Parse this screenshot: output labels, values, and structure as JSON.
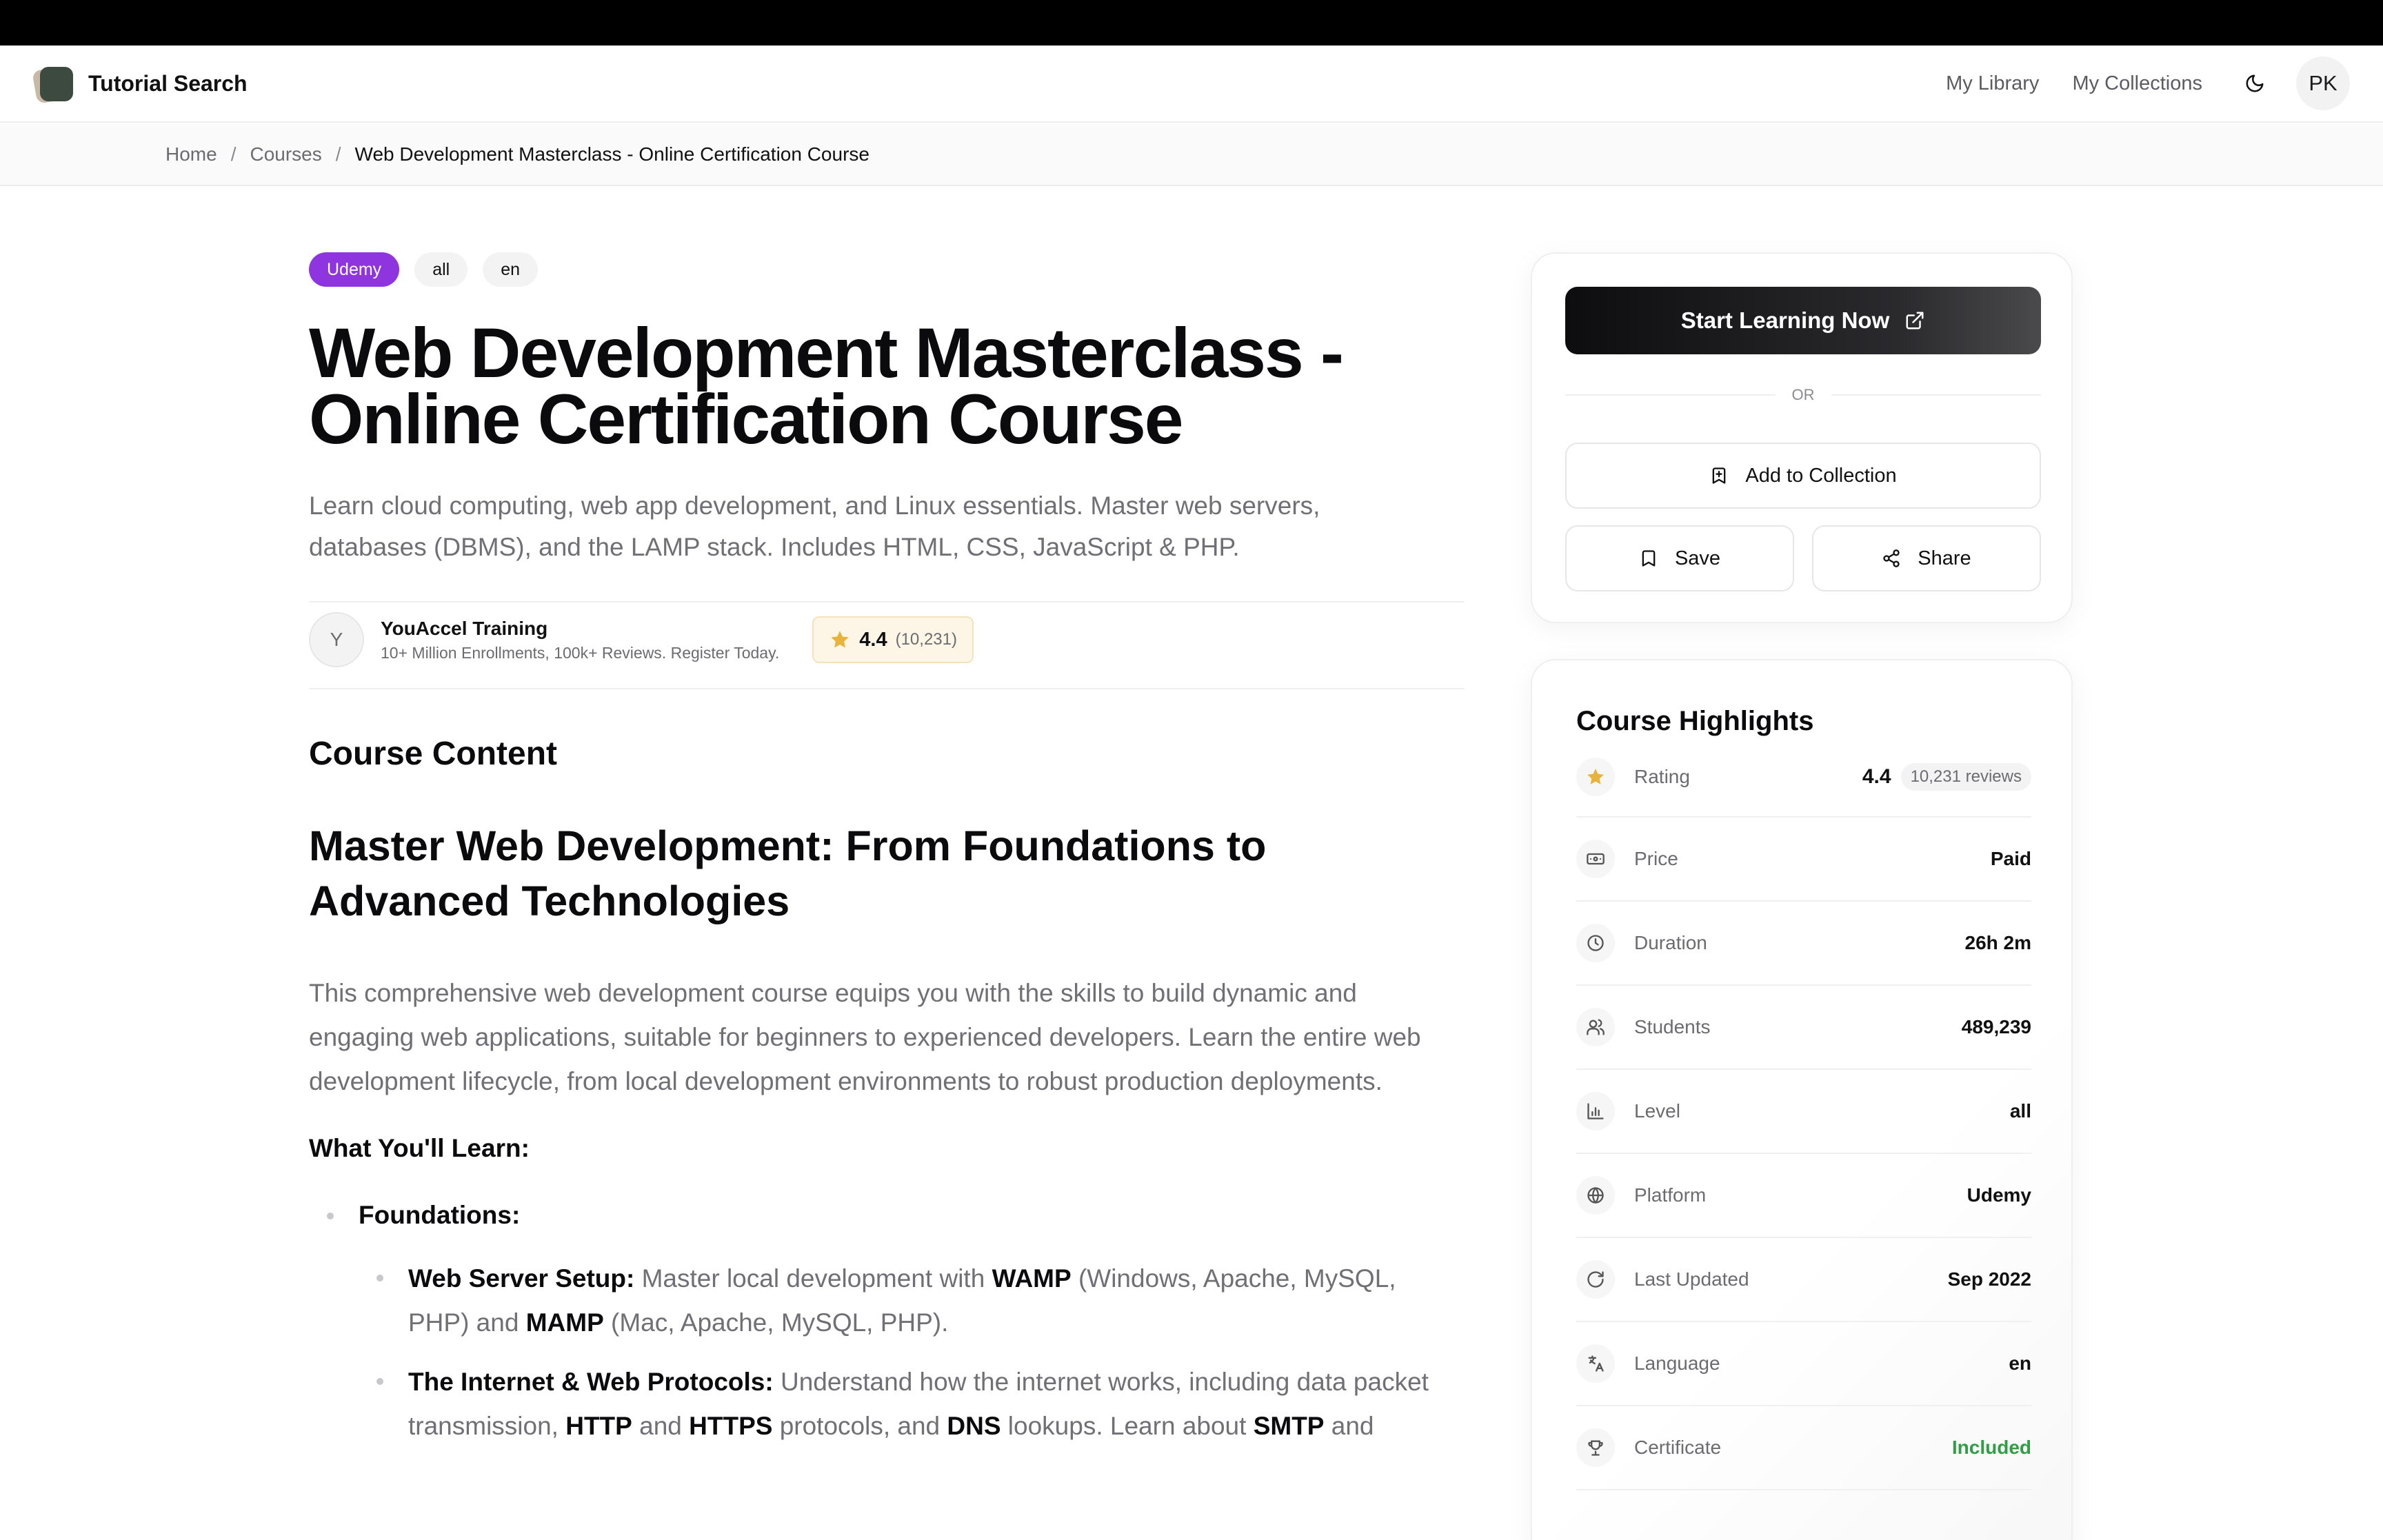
{
  "app": {
    "name": "Tutorial Search"
  },
  "nav": {
    "library": "My Library",
    "collections": "My Collections",
    "avatar_initials": "PK"
  },
  "breadcrumb": {
    "home": "Home",
    "courses": "Courses",
    "current": "Web Development Masterclass - Online Certification Course",
    "separator": "/"
  },
  "tags": {
    "platform": "Udemy",
    "level": "all",
    "language": "en"
  },
  "course": {
    "title": "Web Development Masterclass - Online Certification Course",
    "subtitle": "Learn cloud computing, web app development, and Linux essentials. Master web servers, databases (DBMS), and the LAMP stack. Includes HTML, CSS, JavaScript & PHP.",
    "instructor": {
      "initial": "Y",
      "name": "YouAccel Training",
      "tagline": "10+ Million Enrollments, 100k+ Reviews. Register Today."
    },
    "rating": {
      "value": "4.4",
      "count": "(10,231)"
    }
  },
  "content": {
    "section_heading": "Course Content",
    "heading": "Master Web Development: From Foundations to Advanced Technologies",
    "intro": "This comprehensive web development course equips you with the skills to build dynamic and engaging web applications, suitable for beginners to experienced developers. Learn the entire web development lifecycle, from local development environments to robust production deployments.",
    "learn_heading": "What You'll Learn:",
    "foundations_label": "Foundations:",
    "item1": {
      "title": "Web Server Setup:",
      "t1": " Master local development with ",
      "b1": "WAMP",
      "t2": " (Windows, Apache, MySQL, PHP) and ",
      "b2": "MAMP",
      "t3": " (Mac, Apache, MySQL, PHP)."
    },
    "item2": {
      "title": "The Internet & Web Protocols:",
      "t1": " Understand how the internet works, including data packet transmission, ",
      "b1": "HTTP",
      "t2": " and ",
      "b2": "HTTPS",
      "t3": " protocols, and ",
      "b3": "DNS",
      "t4": " lookups. Learn about ",
      "b4": "SMTP",
      "t5": " and"
    }
  },
  "actions": {
    "start_label": "Start Learning Now",
    "or_label": "OR",
    "add_collection_label": "Add to Collection",
    "save_label": "Save",
    "share_label": "Share"
  },
  "highlights": {
    "title": "Course Highlights",
    "rating": {
      "label": "Rating",
      "value": "4.4",
      "reviews": "10,231 reviews"
    },
    "price": {
      "label": "Price",
      "value": "Paid"
    },
    "duration": {
      "label": "Duration",
      "value": "26h 2m"
    },
    "students": {
      "label": "Students",
      "value": "489,239"
    },
    "level": {
      "label": "Level",
      "value": "all"
    },
    "platform": {
      "label": "Platform",
      "value": "Udemy"
    },
    "updated": {
      "label": "Last Updated",
      "value": "Sep 2022"
    },
    "language": {
      "label": "Language",
      "value": "en"
    },
    "certificate": {
      "label": "Certificate",
      "value": "Included"
    }
  },
  "colors": {
    "brand_purple": "#8f35e0",
    "star": "#e8b33a",
    "green": "#2f9e44",
    "primary_dark": "#111113"
  },
  "icons": [
    "app-logo",
    "moon-icon",
    "star-icon",
    "external-link-icon",
    "bookmark-plus-icon",
    "bookmark-icon",
    "share-icon",
    "banknote-icon",
    "clock-icon",
    "users-icon",
    "bar-chart-icon",
    "globe-icon",
    "refresh-icon",
    "translate-icon",
    "trophy-icon"
  ]
}
